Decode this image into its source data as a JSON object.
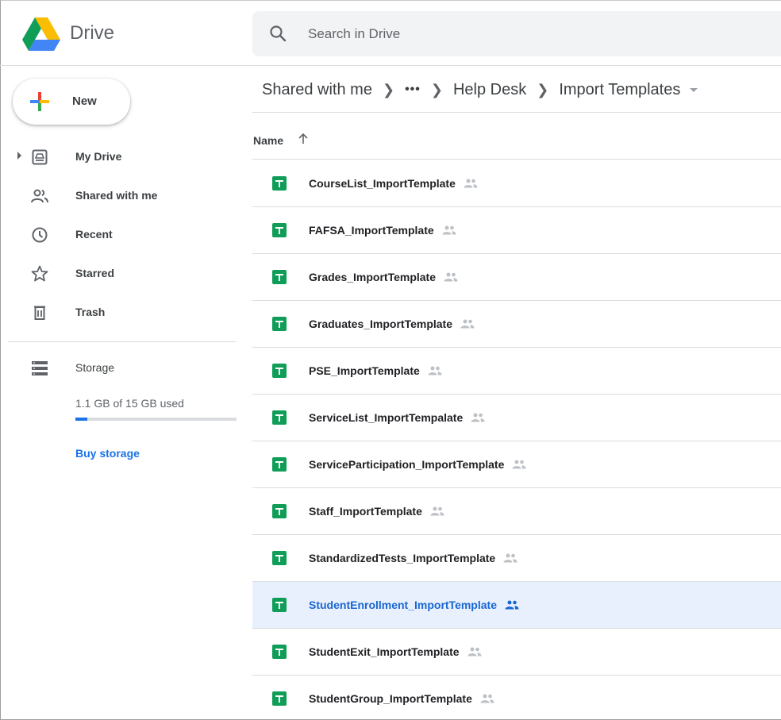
{
  "header": {
    "app_name": "Drive",
    "search_placeholder": "Search in Drive"
  },
  "sidebar": {
    "new_label": "New",
    "items": [
      {
        "label": "My Drive",
        "icon": "my-drive-icon"
      },
      {
        "label": "Shared with me",
        "icon": "shared-with-me-icon"
      },
      {
        "label": "Recent",
        "icon": "recent-icon"
      },
      {
        "label": "Starred",
        "icon": "star-icon"
      },
      {
        "label": "Trash",
        "icon": "trash-icon"
      }
    ],
    "storage": {
      "label": "Storage",
      "used_text": "1.1 GB of 15 GB used",
      "used_fraction": 0.073,
      "buy_label": "Buy storage"
    }
  },
  "breadcrumb": {
    "items": [
      "Shared with me",
      "•••",
      "Help Desk",
      "Import Templates"
    ]
  },
  "file_list": {
    "column_name": "Name",
    "sort": "ascending",
    "files": [
      {
        "name": "CourseList_ImportTemplate",
        "selected": false
      },
      {
        "name": "FAFSA_ImportTemplate",
        "selected": false
      },
      {
        "name": "Grades_ImportTemplate",
        "selected": false
      },
      {
        "name": "Graduates_ImportTemplate",
        "selected": false
      },
      {
        "name": "PSE_ImportTemplate",
        "selected": false
      },
      {
        "name": "ServiceList_ImportTempalate",
        "selected": false
      },
      {
        "name": "ServiceParticipation_ImportTemplate",
        "selected": false
      },
      {
        "name": "Staff_ImportTemplate",
        "selected": false
      },
      {
        "name": "StandardizedTests_ImportTemplate",
        "selected": false
      },
      {
        "name": "StudentEnrollment_ImportTemplate",
        "selected": true
      },
      {
        "name": "StudentExit_ImportTemplate",
        "selected": false
      },
      {
        "name": "StudentGroup_ImportTemplate",
        "selected": false
      }
    ]
  },
  "colors": {
    "accent": "#1a73e8",
    "sheets_green": "#0f9d58",
    "selected_row": "#e8f0fe"
  }
}
